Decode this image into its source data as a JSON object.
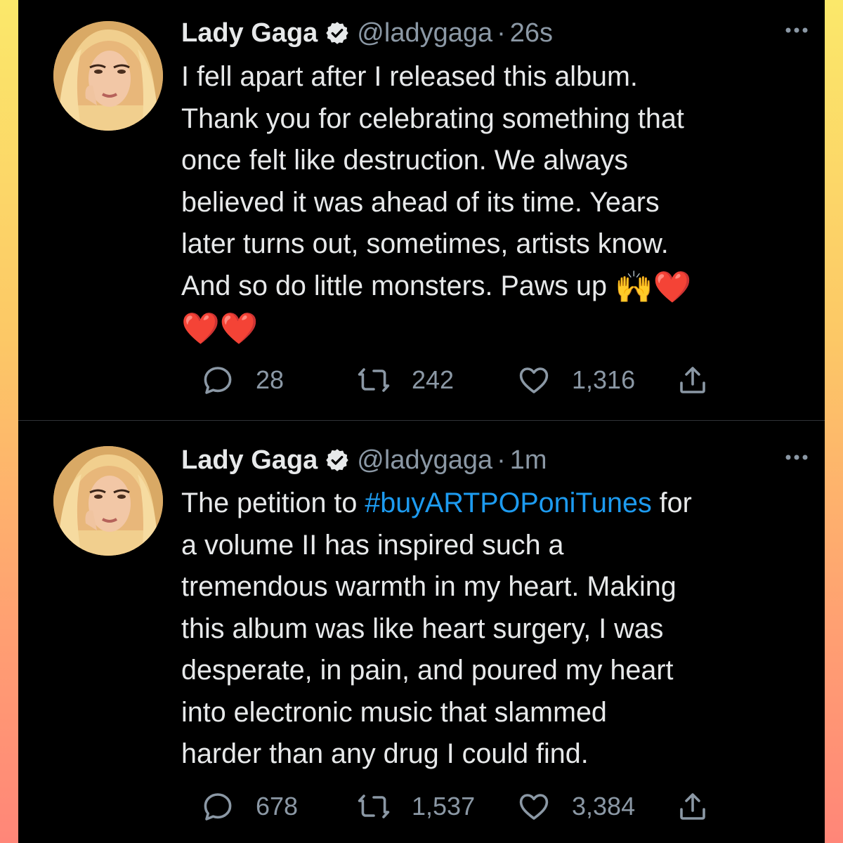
{
  "tweets": [
    {
      "name": "Lady Gaga",
      "handle": "@ladygaga",
      "separator": "·",
      "time": "26s",
      "text_lines": [
        "I fell apart after I released this album.",
        "Thank you for celebrating something that",
        "once felt like destruction. We always",
        "believed it was ahead of its time. Years",
        "later turns out, sometimes, artists know.",
        "And so do little monsters. Paws up"
      ],
      "emoji_inline": "🙌❤️",
      "emoji_line": "❤️❤️",
      "replies": "28",
      "retweets": "242",
      "likes": "1,316"
    },
    {
      "name": "Lady Gaga",
      "handle": "@ladygaga",
      "separator": "·",
      "time": "1m",
      "text_first_pre": "The petition to ",
      "hashtag": "#buyARTPOPoniTunes",
      "text_first_post": " for",
      "text_lines": [
        "a volume II has inspired such a",
        "tremendous warmth in my heart.  Making",
        "this album was like heart surgery, I was",
        "desperate, in pain, and poured my heart",
        "into electronic music that slammed",
        "harder than any drug I could find."
      ],
      "replies": "678",
      "retweets": "1,537",
      "likes": "3,384"
    }
  ],
  "colors": {
    "background": "#000000",
    "text": "#e7e9ea",
    "muted": "#8b98a5",
    "link": "#1d9bf0",
    "frame_top": "#fbe86a",
    "frame_bottom": "#ff8678"
  },
  "icons": [
    "verified-badge-icon",
    "more-icon",
    "reply-icon",
    "retweet-icon",
    "like-icon",
    "share-icon"
  ]
}
